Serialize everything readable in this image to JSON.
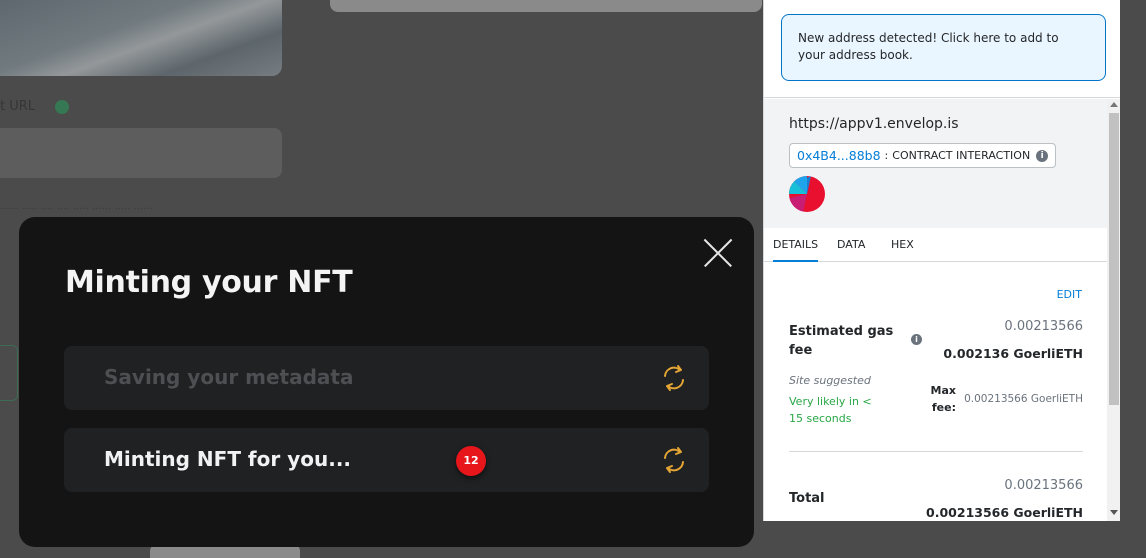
{
  "background": {
    "url_label": "t URL",
    "hint": "...... ..... .... .... ..... ...... ..... ......"
  },
  "modal": {
    "title": "Minting your NFT",
    "steps": [
      {
        "label": "Saving your metadata",
        "state": "inactive"
      },
      {
        "label": "Minting NFT for you...",
        "state": "active"
      }
    ],
    "badge_count": "12",
    "accent_color": "#e6a634",
    "badge_color": "#e6161b"
  },
  "metamask": {
    "alert": "New address detected! Click here to add to your address book.",
    "origin": "https://appv1.envelop.is",
    "contract_address": "0x4B4...88b8",
    "contract_separator": ":",
    "contract_kind": "CONTRACT INTERACTION",
    "tabs": [
      {
        "label": "DETAILS",
        "active": true
      },
      {
        "label": "DATA",
        "active": false
      },
      {
        "label": "HEX",
        "active": false
      }
    ],
    "edit_label": "EDIT",
    "gas": {
      "label": "Estimated gas fee",
      "secondary": "0.00213566",
      "primary": "0.002136 GoerliETH",
      "site_suggested": "Site suggested",
      "likely": "Very likely in < 15 seconds",
      "max_fee_label": "Max fee:",
      "max_fee_value": "0.00213566 GoerliETH"
    },
    "total": {
      "label": "Total",
      "secondary": "0.00213566",
      "primary": "0.00213566 GoerliETH"
    },
    "link_color": "#037dd6",
    "success_color": "#28a745"
  }
}
